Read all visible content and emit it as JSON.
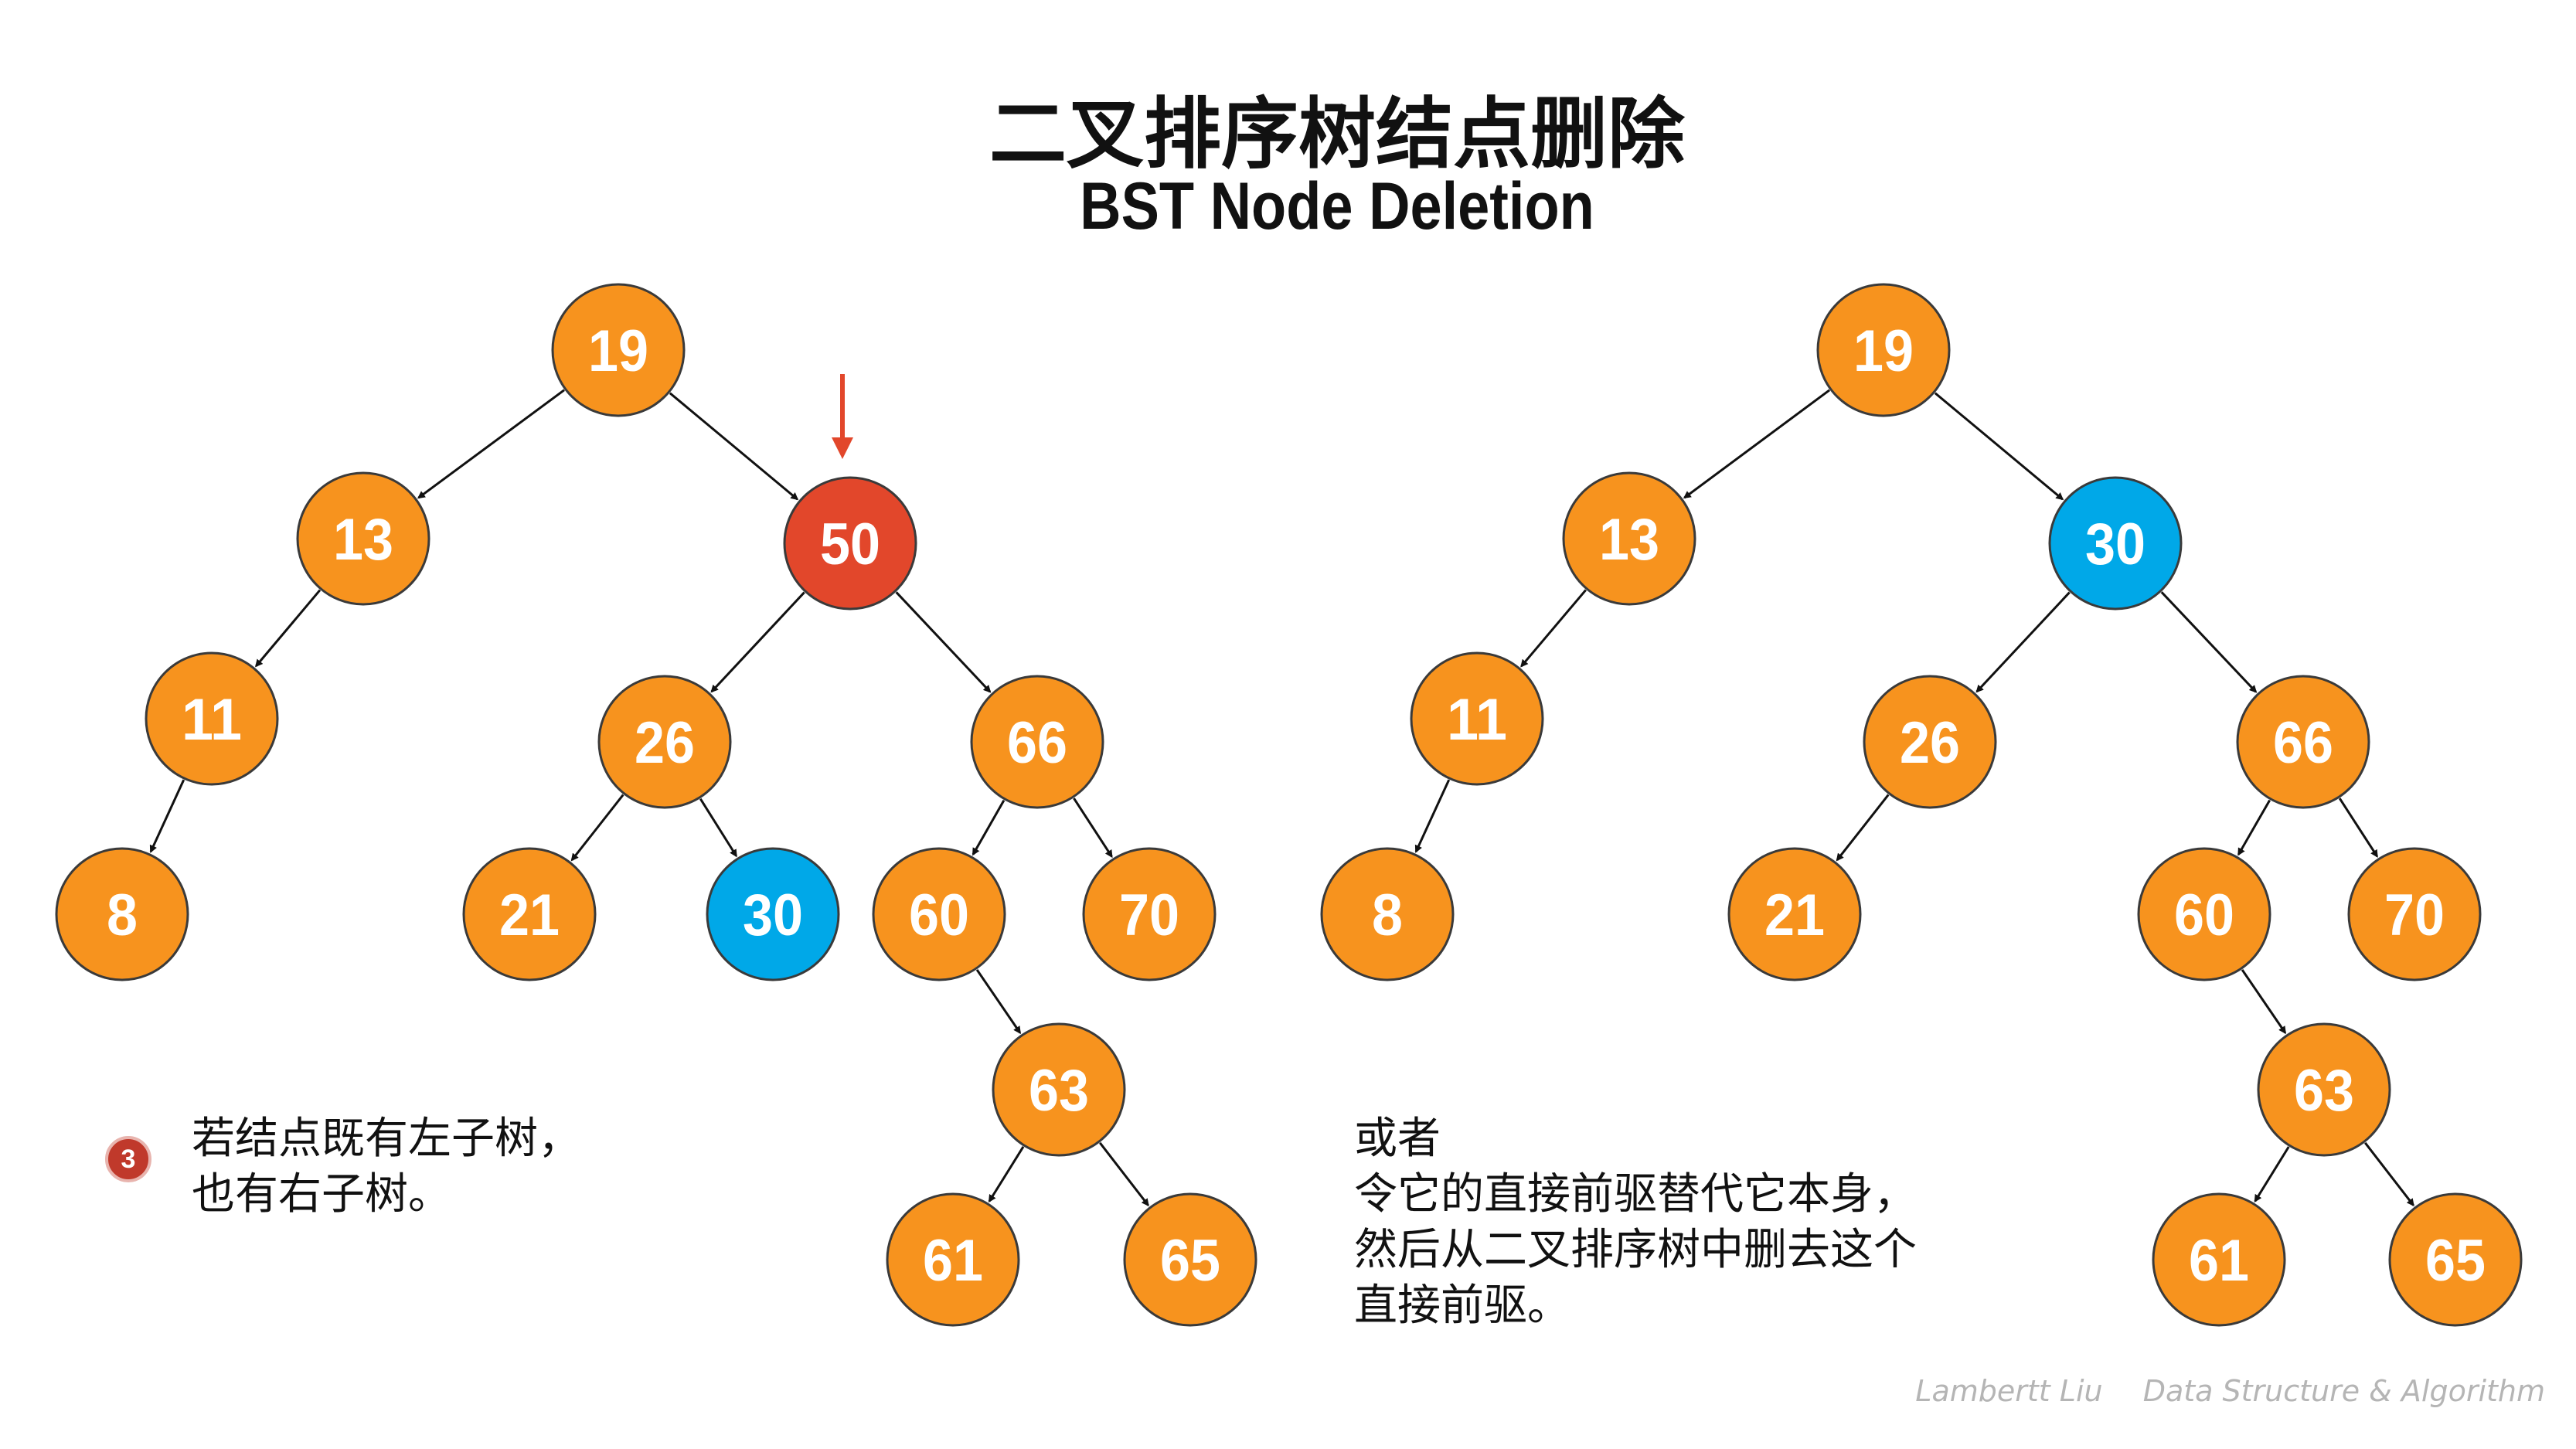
{
  "title": "二叉排序树结点删除",
  "subtitle": "BST Node Deletion",
  "step_number": "3",
  "left_note": [
    "若结点既有左子树，",
    "也有右子树。"
  ],
  "right_note": [
    "或者",
    "令它的直接前驱替代它本身，",
    "然后从二叉排序树中删去这个",
    "直接前驱。"
  ],
  "credit_author": "Lambertt Liu",
  "credit_course": "Data Structure & Algorithm",
  "colors": {
    "node_default": "#f7931e",
    "node_deleted": "#e2472b",
    "node_predecessor": "#00a8e8",
    "arrow_marker": "#e2472b"
  },
  "trees": [
    {
      "id": "before",
      "nodes": [
        {
          "key": "19",
          "state": "default"
        },
        {
          "key": "13",
          "state": "default"
        },
        {
          "key": "50",
          "state": "deleted"
        },
        {
          "key": "11",
          "state": "default"
        },
        {
          "key": "8",
          "state": "default"
        },
        {
          "key": "26",
          "state": "default"
        },
        {
          "key": "66",
          "state": "default"
        },
        {
          "key": "21",
          "state": "default"
        },
        {
          "key": "30",
          "state": "predecessor"
        },
        {
          "key": "60",
          "state": "default"
        },
        {
          "key": "70",
          "state": "default"
        },
        {
          "key": "63",
          "state": "default"
        },
        {
          "key": "61",
          "state": "default"
        },
        {
          "key": "65",
          "state": "default"
        }
      ],
      "edges": [
        [
          "19",
          "13"
        ],
        [
          "19",
          "50"
        ],
        [
          "13",
          "11"
        ],
        [
          "11",
          "8"
        ],
        [
          "50",
          "26"
        ],
        [
          "50",
          "66"
        ],
        [
          "26",
          "21"
        ],
        [
          "26",
          "30"
        ],
        [
          "66",
          "60"
        ],
        [
          "66",
          "70"
        ],
        [
          "60",
          "63"
        ],
        [
          "63",
          "61"
        ],
        [
          "63",
          "65"
        ]
      ],
      "marked_node": "50"
    },
    {
      "id": "after",
      "nodes": [
        {
          "key": "19",
          "state": "default"
        },
        {
          "key": "13",
          "state": "default"
        },
        {
          "key": "30",
          "state": "predecessor"
        },
        {
          "key": "11",
          "state": "default"
        },
        {
          "key": "8",
          "state": "default"
        },
        {
          "key": "26",
          "state": "default"
        },
        {
          "key": "66",
          "state": "default"
        },
        {
          "key": "21",
          "state": "default"
        },
        {
          "key": "60",
          "state": "default"
        },
        {
          "key": "70",
          "state": "default"
        },
        {
          "key": "63",
          "state": "default"
        },
        {
          "key": "61",
          "state": "default"
        },
        {
          "key": "65",
          "state": "default"
        }
      ],
      "edges": [
        [
          "19",
          "13"
        ],
        [
          "19",
          "30"
        ],
        [
          "13",
          "11"
        ],
        [
          "11",
          "8"
        ],
        [
          "30",
          "26"
        ],
        [
          "30",
          "66"
        ],
        [
          "26",
          "21"
        ],
        [
          "66",
          "60"
        ],
        [
          "66",
          "70"
        ],
        [
          "60",
          "63"
        ],
        [
          "63",
          "61"
        ],
        [
          "63",
          "65"
        ]
      ]
    }
  ]
}
